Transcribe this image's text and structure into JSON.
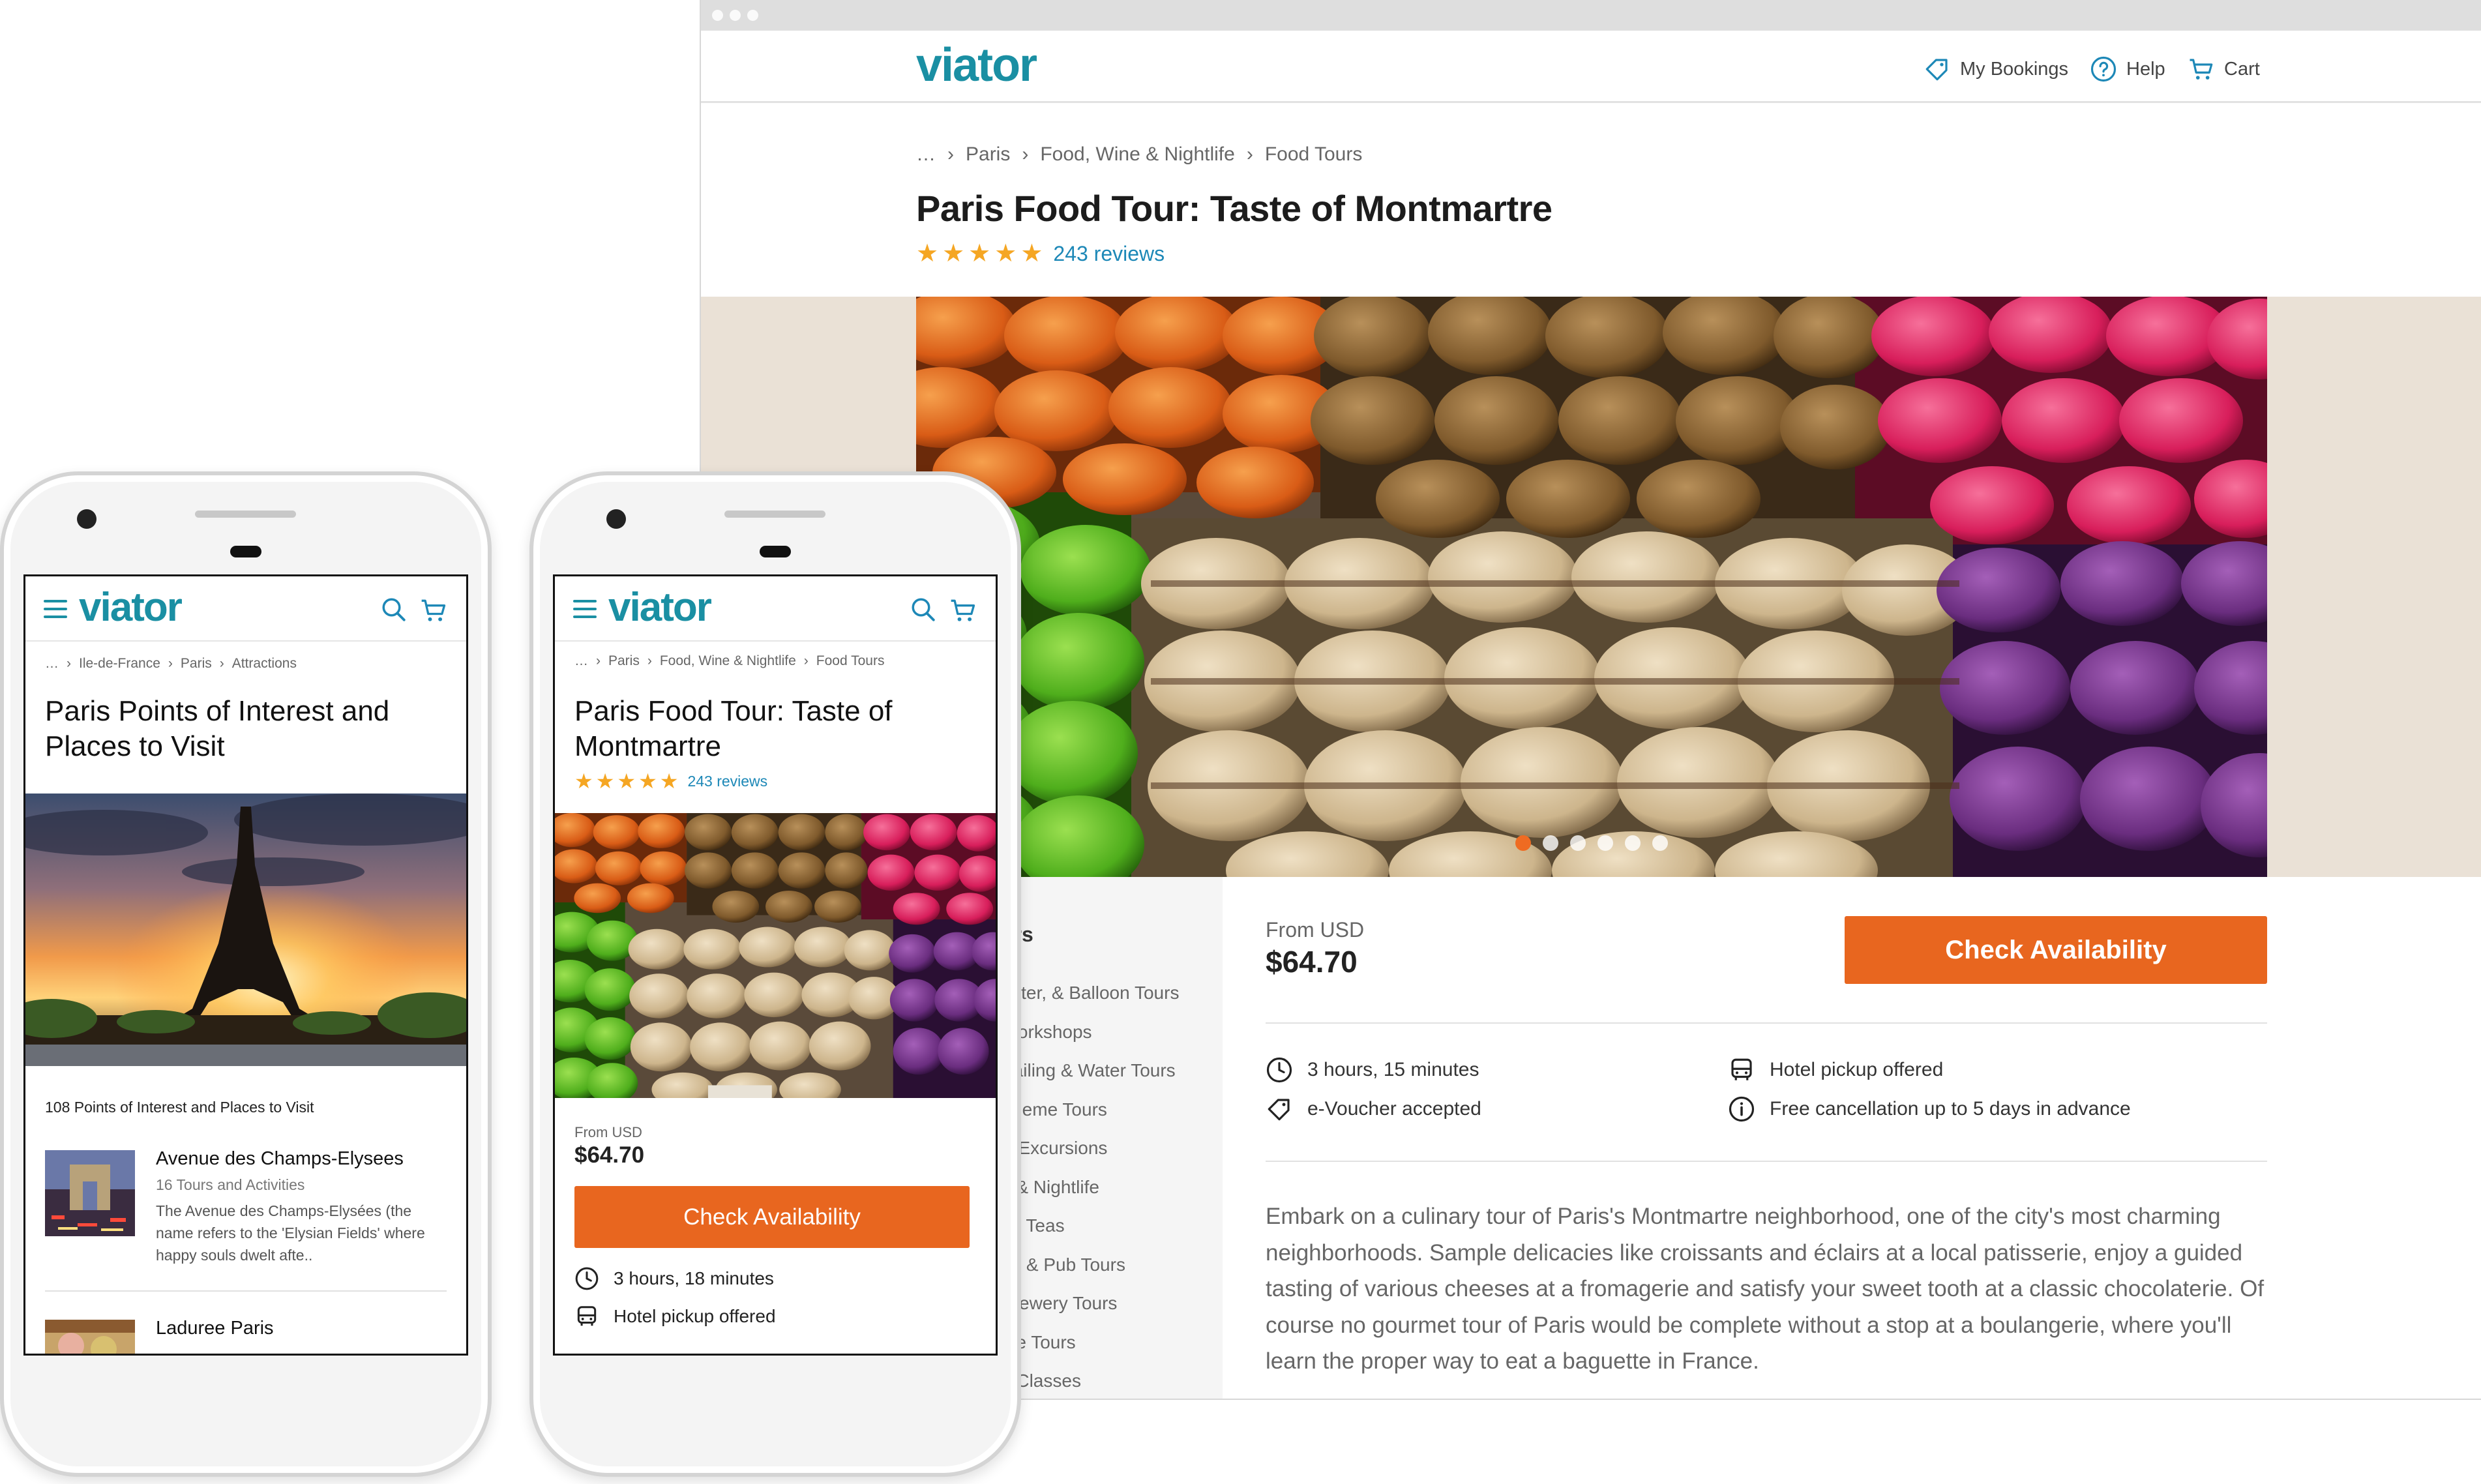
{
  "colors": {
    "brand": "#1a8fa3",
    "accent": "#e8661f",
    "stars": "#f5a623",
    "link": "#1d88b7"
  },
  "desktop": {
    "header": {
      "logo": "viator",
      "nav": [
        {
          "label": "My Bookings",
          "icon": "tag-icon"
        },
        {
          "label": "Help",
          "icon": "help-circle-icon"
        },
        {
          "label": "Cart",
          "icon": "cart-icon"
        }
      ]
    },
    "breadcrumb": [
      "…",
      "›",
      "Paris",
      "›",
      "Food, Wine & Nightlife",
      "›",
      "Food Tours"
    ],
    "title": "Paris Food Tour: Taste of Montmartre",
    "rating_stars": 5,
    "reviews": "243 reviews",
    "carousel": {
      "slides": 6,
      "active": 1
    },
    "sidebar": {
      "heading": "urs",
      "items": [
        "opter, & Balloon Tours",
        "Workshops",
        "Sailing & Water Tours",
        "Theme Tours",
        "& Excursions",
        "e & Nightlife",
        "on Teas",
        "ub & Pub Tours",
        "Brewery Tours",
        "ate Tours",
        "g Classes"
      ]
    },
    "price": {
      "from_label": "From USD",
      "amount": "$64.70"
    },
    "check_availability": "Check Availability",
    "features": {
      "duration": "3 hours, 15 minutes",
      "voucher": "e-Voucher accepted",
      "pickup": "Hotel pickup offered",
      "cancellation": "Free cancellation up to 5 days in advance"
    },
    "description": "Embark on a culinary tour of Paris's Montmartre neighborhood, one of the city's most charming neighborhoods. Sample delicacies like croissants and éclairs at a local patisserie, enjoy a guided tasting of various cheeses at a fromagerie and satisfy your sweet tooth at a classic chocolaterie. Of course no gourmet tour of Paris would be complete without a stop at a boulangerie, where you'll learn the proper way to eat a baguette in France."
  },
  "phone1": {
    "logo": "viator",
    "breadcrumb": [
      "…",
      "›",
      "Ile-de-France",
      "›",
      "Paris",
      "›",
      "Attractions"
    ],
    "title": "Paris Points of Interest and Places to Visit",
    "count": "108 Points of Interest and Places to Visit",
    "items": [
      {
        "name": "Avenue des Champs-Elysees",
        "sub": "16 Tours and Activities",
        "desc": "The Avenue des Champs-Elysées (the name refers to the 'Elysian Fields' where happy souls dwelt afte.."
      },
      {
        "name": "Laduree Paris",
        "sub": "",
        "desc": ""
      }
    ]
  },
  "phone2": {
    "logo": "viator",
    "breadcrumb": [
      "…",
      "›",
      "Paris",
      "›",
      "Food, Wine & Nightlife",
      "›",
      "Food Tours"
    ],
    "title": "Paris Food Tour: Taste of Montmartre",
    "rating_stars": 5,
    "reviews": "243 reviews",
    "price": {
      "from_label": "From USD",
      "amount": "$64.70"
    },
    "check_availability": "Check Availability",
    "features": {
      "duration": "3 hours, 18 minutes",
      "pickup": "Hotel pickup offered"
    }
  }
}
